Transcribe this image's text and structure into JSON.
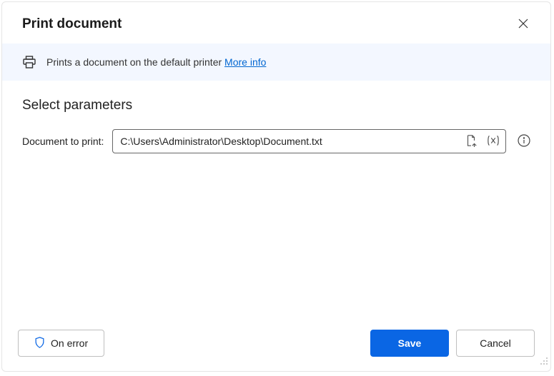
{
  "header": {
    "title": "Print document"
  },
  "banner": {
    "text": "Prints a document on the default printer ",
    "more_info": "More info"
  },
  "params": {
    "section_title": "Select parameters",
    "doc_label": "Document to print:",
    "doc_value": "C:\\Users\\Administrator\\Desktop\\Document.txt"
  },
  "footer": {
    "on_error": "On error",
    "save": "Save",
    "cancel": "Cancel"
  }
}
